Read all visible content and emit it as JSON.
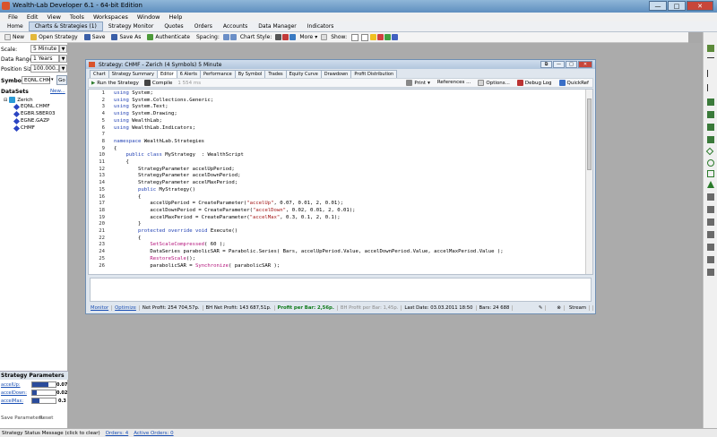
{
  "app": {
    "title": "Wealth-Lab Developer 6.1 - 64-bit Edition",
    "min": "—",
    "max": "□",
    "close": "✕"
  },
  "menu": [
    "File",
    "Edit",
    "View",
    "Tools",
    "Workspaces",
    "Window",
    "Help"
  ],
  "nav": {
    "home": "Home",
    "charts": "Charts & Strategies (1)",
    "monitor": "Strategy Monitor",
    "quotes": "Quotes",
    "orders": "Orders",
    "accounts": "Accounts",
    "data_manager": "Data Manager",
    "indicators": "Indicators"
  },
  "toolbar": {
    "new": "New",
    "open": "Open Strategy",
    "save": "Save",
    "save_as": "Save As",
    "authenticate": "Authenticate",
    "spacing": "Spacing:",
    "chart_style": "Chart Style:",
    "more": "More",
    "show": "Show:"
  },
  "left": {
    "scale_label": "Scale:",
    "scale_value": "5 Minute",
    "range_label": "Data Range:",
    "range_value": "1 Years",
    "pos_label": "Position Size:",
    "pos_value": "100.000...",
    "symbol_label": "Symbol:",
    "symbol_value": "EQNL.CHM",
    "go": "Go",
    "datasets": "DataSets",
    "new_link": "New...",
    "root": "Zerich",
    "symbols": [
      "EQNL.CHMF",
      "EGBR.SBER03",
      "EGNE.GAZP",
      "CHMF"
    ],
    "sp_title": "Strategy Parameters",
    "params": [
      {
        "name": "accelUp:",
        "value": "0.07",
        "fill": 0.7
      },
      {
        "name": "accelDown:",
        "value": "0.02",
        "fill": 0.2
      },
      {
        "name": "accelMax:",
        "value": "0.3",
        "fill": 0.3
      }
    ],
    "save_params": "Save Parameters",
    "reset": "Reset"
  },
  "status": {
    "message": "Strategy Status Message (click to clear)",
    "orders": "Orders: 4",
    "active": "Active Orders: 0"
  },
  "strategy_window": {
    "title": "Strategy: CHMF - Zerich (4 Symbols) 5 Minute",
    "tabs": [
      "Chart",
      "Strategy Summary",
      "Editor",
      "6 Alerts",
      "Performance",
      "By Symbol",
      "Trades",
      "Equity Curve",
      "Drawdown",
      "Profit Distribution"
    ],
    "run": "Run the Strategy",
    "compile": "Compile",
    "time": "1 554 ms",
    "print": "Print",
    "references": "References ...",
    "options": "Options...",
    "debug": "Debug Log",
    "quickref": "QuickRef",
    "code": [
      "using System;",
      "using System.Collections.Generic;",
      "using System.Text;",
      "using System.Drawing;",
      "using WealthLab;",
      "using WealthLab.Indicators;",
      "",
      "namespace WealthLab.Strategies",
      "{",
      "    public class MyStrategy  : WealthScript",
      "    {",
      "        StrategyParameter accelUpPeriod;",
      "        StrategyParameter accelDownPeriod;",
      "        StrategyParameter accelMaxPeriod;",
      "        public MyStrategy()",
      "        {",
      "            accelUpPeriod = CreateParameter(\"accelUp\", 0.07, 0.01, 2, 0.01);",
      "            accelDownPeriod = CreateParameter(\"accelDown\", 0.02, 0.01, 2, 0.01);",
      "            accelMaxPeriod = CreateParameter(\"accelMax\", 0.3, 0.1, 2, 0.1);",
      "        }",
      "        protected override void Execute()",
      "        {",
      "            SetScaleCompressed( 60 );",
      "            DataSeries parabolicSAR = Parabolic.Series( Bars, accelUpPeriod.Value, accelDownPeriod.Value, accelMaxPeriod.Value );",
      "            RestoreScale();",
      "            parabolicSAR = Synchronize( parabolicSAR );"
    ],
    "status": {
      "monitor": "Monitor",
      "optimize": "Optimize",
      "net_profit": "Net Profit: 254 704,57р.",
      "bh_net": "BH Net Profit: 143 687,51р.",
      "ppb": "Profit per Bar: 2,56р.",
      "bh_ppb": "BH Profit per Bar: 1,45р.",
      "last_date": "Last Date: 03.03.2011 18:50",
      "bars": "Bars: 24 688",
      "streaming": "Stream"
    }
  }
}
